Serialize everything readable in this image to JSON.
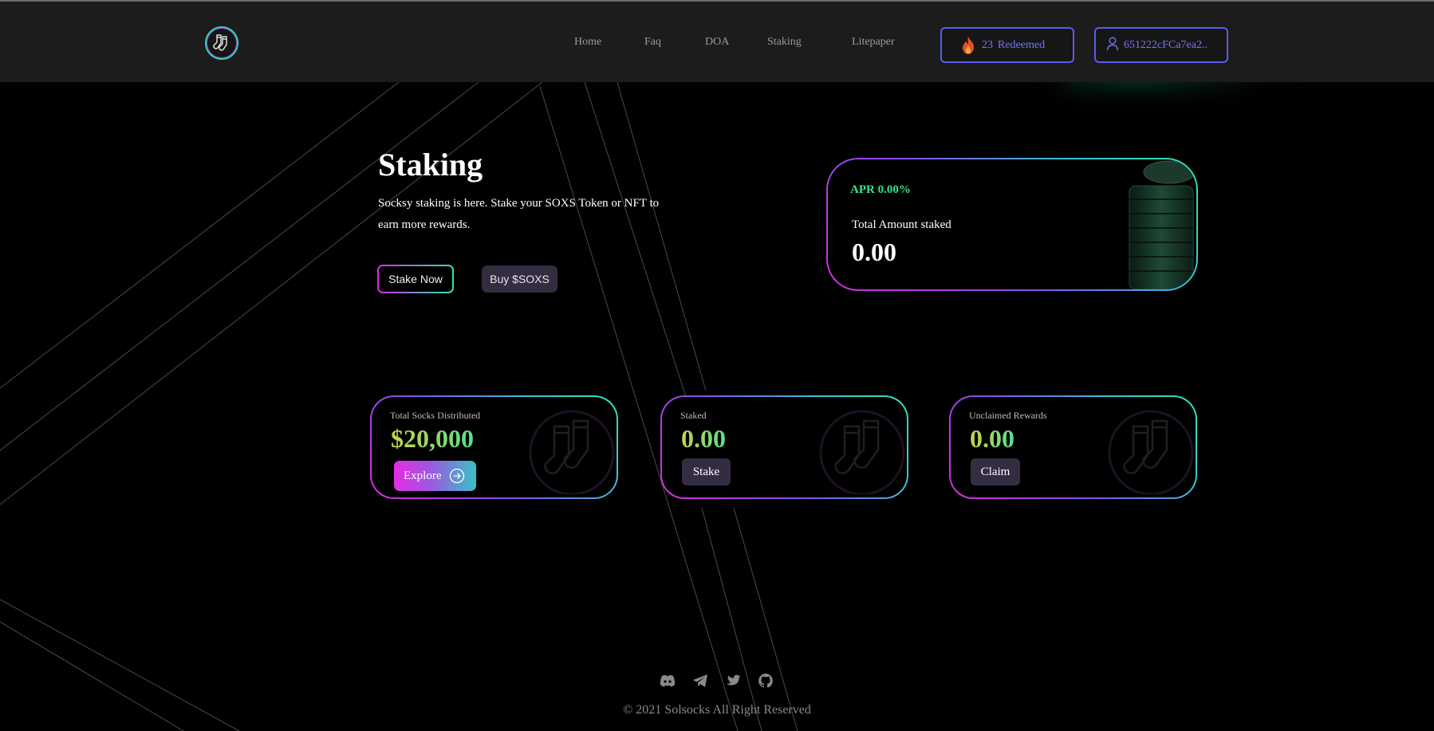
{
  "nav": {
    "links": [
      "Home",
      "Faq",
      "DOA",
      "Staking",
      "Litepaper"
    ],
    "redeemed_count": "23",
    "redeemed_label": "Redeemed",
    "wallet": "651222cFCa7ea2.."
  },
  "hero": {
    "title": "Staking",
    "text": "Socksy staking is here. Stake your SOXS Token or NFT to earn more rewards.",
    "stake_now": "Stake Now",
    "buy": "Buy $SOXS"
  },
  "apr_card": {
    "apr": "APR 0.00%",
    "total_label": "Total Amount staked",
    "total_value": "0.00"
  },
  "stats": [
    {
      "label": "Total Socks Distributed",
      "value": "$20,000",
      "button": "Explore"
    },
    {
      "label": "Staked",
      "value": "0.00",
      "button": "Stake"
    },
    {
      "label": "Unclaimed Rewards",
      "value": "0.00",
      "button": "Claim"
    }
  ],
  "footer": {
    "social_icons": [
      "discord-icon",
      "telegram-icon",
      "twitter-icon",
      "github-icon"
    ],
    "copyright": "© 2021 Solsocks All Right Reserved"
  },
  "colors": {
    "accent_green": "#2ee88c",
    "accent_purple": "#d92ce0",
    "accent_blue": "#5b5bf2",
    "button_dark": "#342d42"
  }
}
